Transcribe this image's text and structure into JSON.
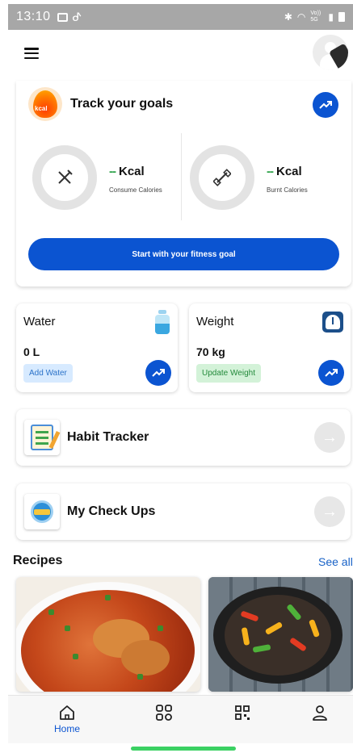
{
  "status_bar": {
    "time": "13:10",
    "network": "Vo)) 5G"
  },
  "goals": {
    "title": "Track your goals",
    "icon_text": "kcal",
    "consumed": {
      "value": "-- Kcal",
      "dash": "--",
      "unit": "Kcal",
      "label": "Consume Calories"
    },
    "burnt": {
      "value": "-- Kcal",
      "dash": "--",
      "unit": "Kcal",
      "label": "Burnt Calories"
    },
    "cta": "Start with your fitness goal"
  },
  "water": {
    "title": "Water",
    "value": "0 L",
    "action": "Add Water"
  },
  "weight": {
    "title": "Weight",
    "value": "70 kg",
    "action": "Update Weight"
  },
  "rows": [
    {
      "title": "Habit Tracker"
    },
    {
      "title": "My Check Ups"
    }
  ],
  "recipes": {
    "title": "Recipes",
    "see_all": "See all"
  },
  "nav": {
    "home": "Home"
  },
  "colors": {
    "primary": "#0b54d1",
    "accent_green": "#2ea34a",
    "indicator": "#3bd163"
  }
}
